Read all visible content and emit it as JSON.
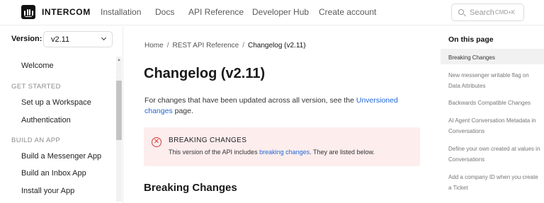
{
  "header": {
    "brand": "INTERCOM",
    "nav": [
      "Installation",
      "Docs",
      "API Reference",
      "Developer Hub",
      "Create account"
    ],
    "search": {
      "placeholder": "Search",
      "shortcut": "CMD+K"
    }
  },
  "sidebar": {
    "version_label": "Version:",
    "version_value": "v2.11",
    "items": {
      "welcome": "Welcome",
      "section_get_started": "GET STARTED",
      "setup_workspace": "Set up a Workspace",
      "authentication": "Authentication",
      "section_build_app": "BUILD AN APP",
      "build_messenger": "Build a Messenger App",
      "build_inbox": "Build an Inbox App",
      "install_app": "Install your App"
    }
  },
  "breadcrumb": {
    "home": "Home",
    "sep": "/",
    "section": "REST API Reference",
    "current": "Changelog (v2.11)"
  },
  "main": {
    "title": "Changelog (v2.11)",
    "intro_before": "For changes that have been updated across all version, see the",
    "intro_link": "Unversioned changes",
    "intro_after": "page.",
    "callout": {
      "title": "BREAKING CHANGES",
      "body_before": "This version of the API includes",
      "body_link": "breaking changes",
      "body_after": ". They are listed below."
    },
    "section_heading": "Breaking Changes"
  },
  "toc": {
    "title": "On this page",
    "items": [
      "Breaking Changes",
      "New messenger writable flag on Data Attributes",
      "Backwards Compatible Changes",
      "AI Agent Conversation Metadata in Conversations",
      "Define your own created at values in Conversations",
      "Add a company ID when you create a Ticket"
    ]
  },
  "colors": {
    "link": "#2268d8",
    "callout_bg": "#fdeded",
    "error": "#d73a3a"
  }
}
